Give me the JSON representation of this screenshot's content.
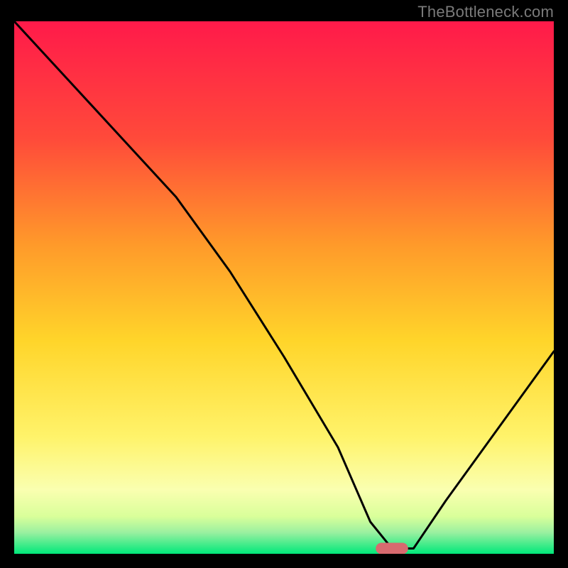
{
  "watermark": "TheBottleneck.com",
  "chart_data": {
    "type": "line",
    "title": "",
    "xlabel": "",
    "ylabel": "",
    "xlim": [
      0,
      100
    ],
    "ylim": [
      0,
      100
    ],
    "grid": false,
    "legend": false,
    "series": [
      {
        "name": "bottleneck-curve",
        "x": [
          0,
          10,
          20,
          30,
          40,
          50,
          60,
          66,
          70,
          74,
          80,
          90,
          100
        ],
        "y": [
          100,
          89,
          78,
          67,
          53,
          37,
          20,
          6,
          1,
          1,
          10,
          24,
          38
        ]
      }
    ],
    "marker": {
      "name": "optimal-zone",
      "x_start": 67,
      "x_end": 73,
      "y": 1,
      "color": "#d86a6f"
    },
    "background_gradient": {
      "top": "#ff1a4a",
      "mid_upper": "#ff8a2a",
      "mid": "#ffd52a",
      "mid_lower": "#fff36a",
      "near_bottom": "#d9ff8a",
      "bottom": "#00e87a"
    }
  }
}
